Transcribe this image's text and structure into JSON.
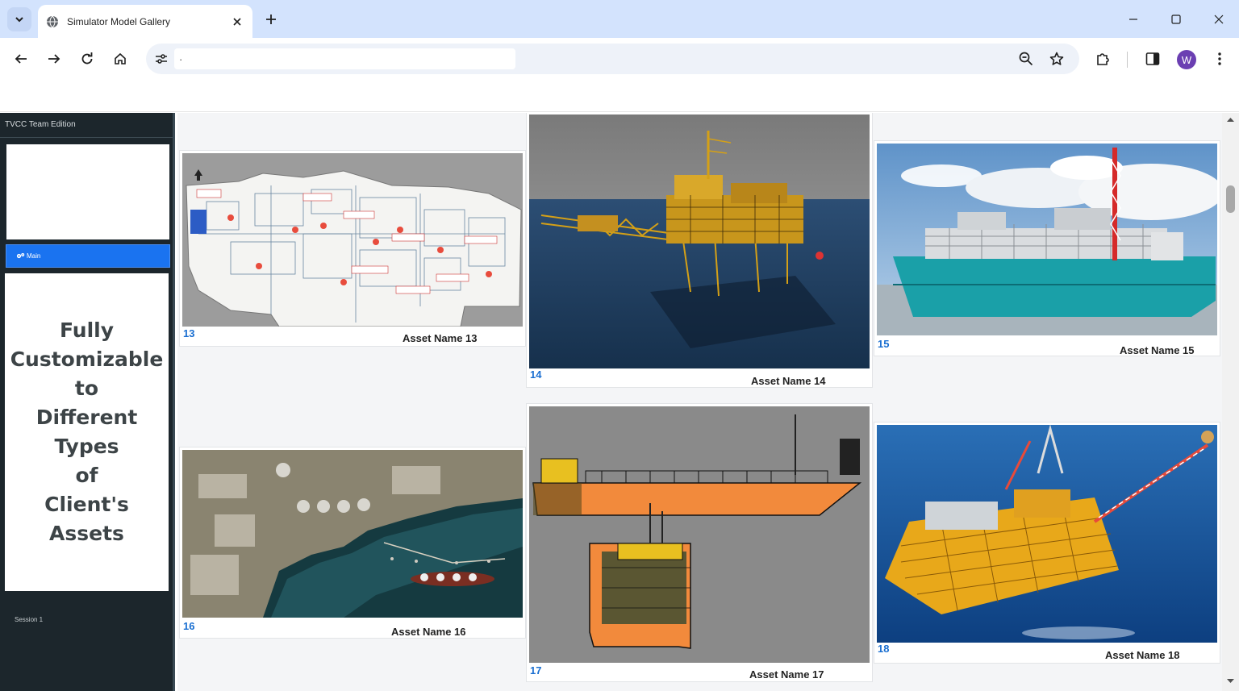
{
  "browser": {
    "tab_title": "Simulator Model Gallery",
    "url": "·",
    "profile_initial": "W"
  },
  "sidebar": {
    "app_title": "TVCC Team Edition",
    "main_label": "Main",
    "promo_text": "Fully\nCustomizable\nto\nDifferent Types\nof\nClient's Assets",
    "session_label": "Session 1"
  },
  "gallery": {
    "items": [
      {
        "number": "13",
        "name": "Asset Name 13"
      },
      {
        "number": "14",
        "name": "Asset Name 14"
      },
      {
        "number": "15",
        "name": "Asset Name 15"
      },
      {
        "number": "16",
        "name": "Asset Name 16"
      },
      {
        "number": "17",
        "name": "Asset Name 17"
      },
      {
        "number": "18",
        "name": "Asset Name 18"
      }
    ]
  },
  "colors": {
    "tabstrip": "#d3e3fd",
    "sidebar_bg": "#1c262c",
    "main_button": "#1a73f0",
    "asset_number": "#1a6fd1"
  }
}
